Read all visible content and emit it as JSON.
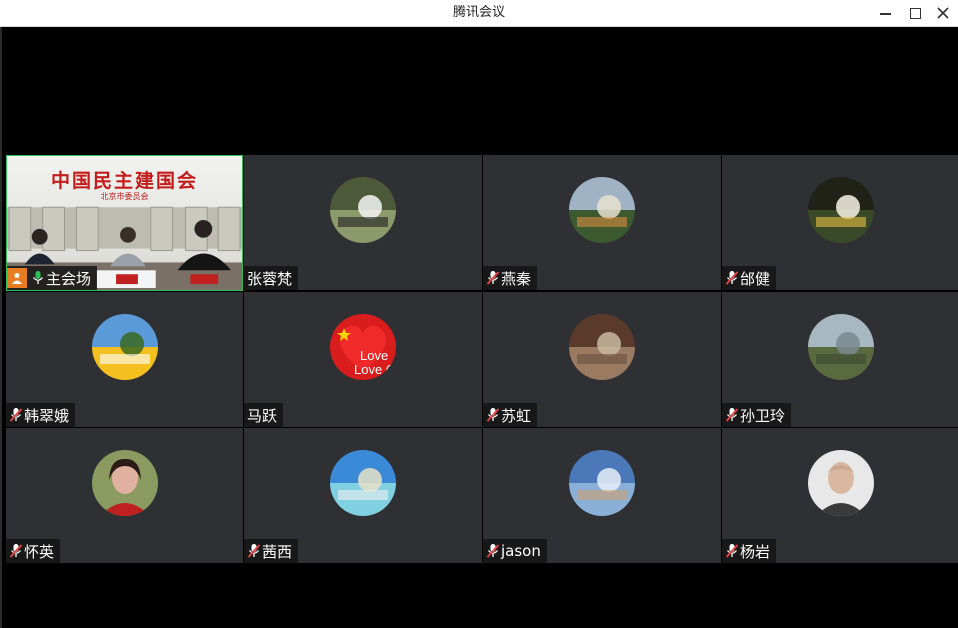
{
  "window": {
    "title": "腾讯会议"
  },
  "main_video": {
    "backdrop_title": "中国民主建国会",
    "backdrop_subtitle": "北京市委员会",
    "name": "主会场"
  },
  "participants": [
    {
      "name": "张蓉梵",
      "avatar": "panda-photo"
    },
    {
      "name": "燕秦",
      "avatar": "rainbow-building-photo"
    },
    {
      "name": "邰健",
      "avatar": "white-flower-photo"
    },
    {
      "name": "韩翠娥",
      "avatar": "sunflower-field-photo"
    },
    {
      "name": "马跃",
      "avatar": "love-china-flag-heart",
      "avatar_text": "Love Chin"
    },
    {
      "name": "苏虹",
      "avatar": "cat-photo"
    },
    {
      "name": "孙卫玲",
      "avatar": "lake-trees-photo"
    },
    {
      "name": "怀英",
      "avatar": "woman-portrait-photo"
    },
    {
      "name": "茜西",
      "avatar": "beach-photo"
    },
    {
      "name": "jason",
      "avatar": "sky-clouds-photo"
    },
    {
      "name": "杨岩",
      "avatar": "man-portrait-photo"
    }
  ],
  "colors": {
    "tile": "#2f3033",
    "active_border": "#2fbf58",
    "host_badge": "#e77c23",
    "mic_muted": "#e04040"
  }
}
